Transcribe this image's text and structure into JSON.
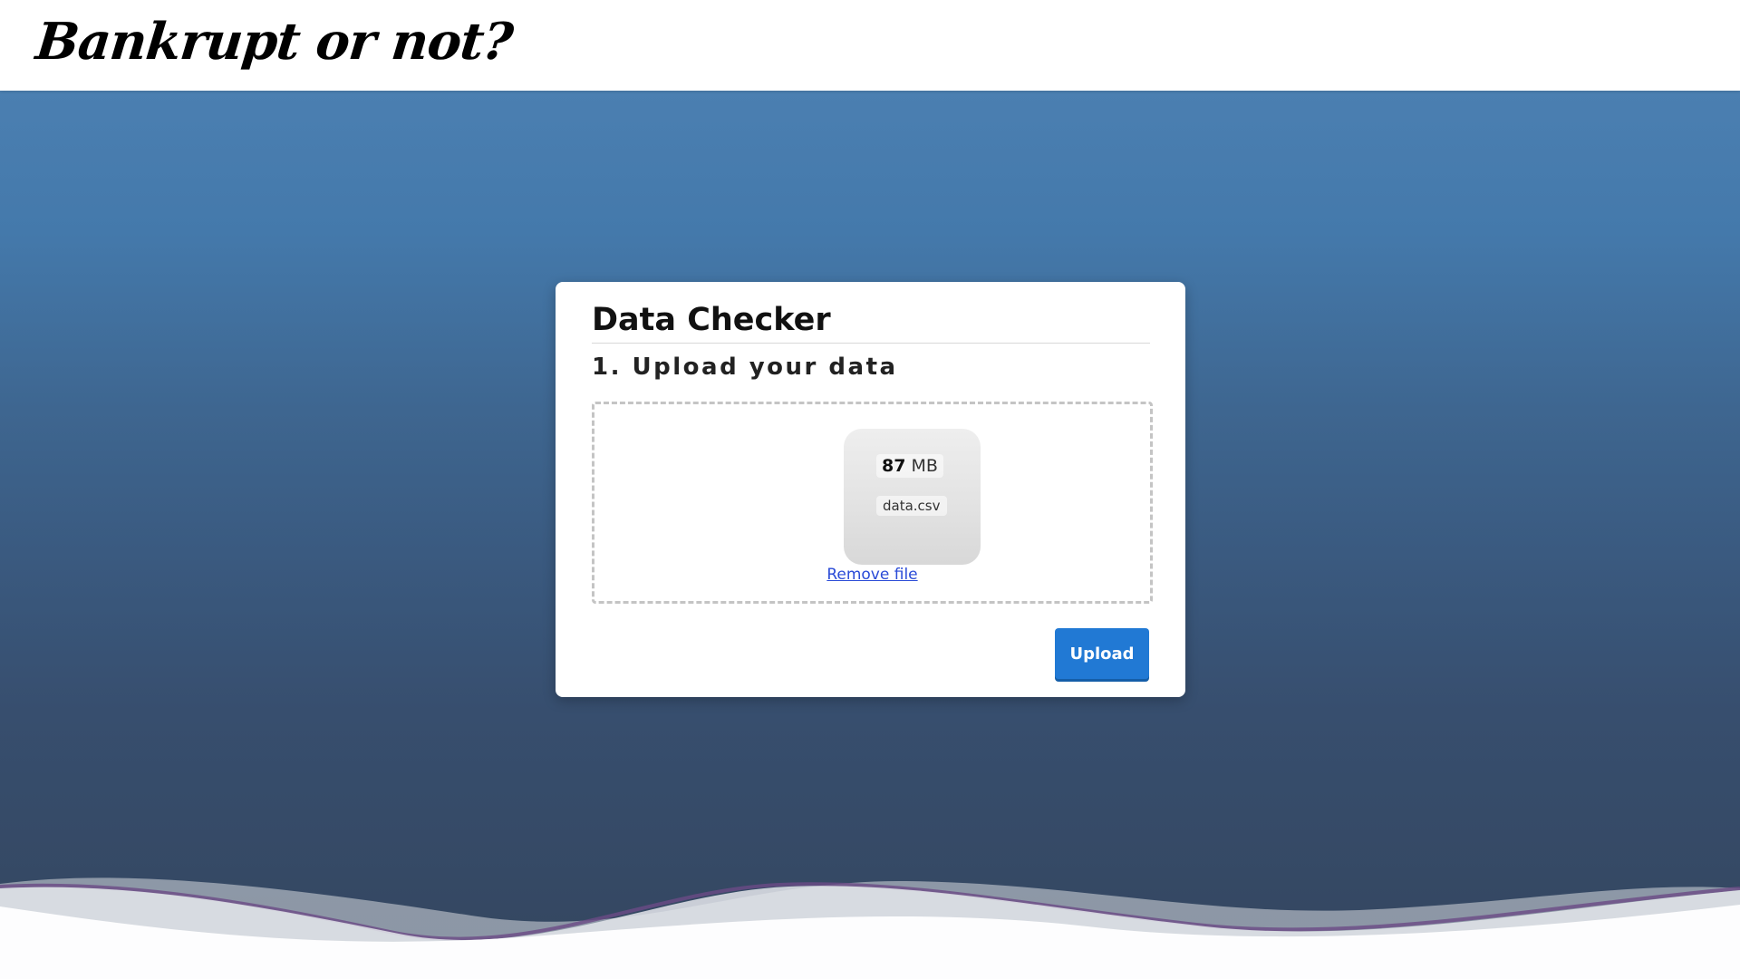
{
  "header": {
    "brand": "Bankrupt or not?"
  },
  "card": {
    "title": "Data Checker",
    "step_title": "1. Upload your data",
    "file": {
      "size_value": "87",
      "size_unit": "MB",
      "name": "data.csv",
      "remove_label": "Remove file"
    },
    "upload_label": "Upload"
  },
  "colors": {
    "gradient_top": "#4b7fb1",
    "gradient_bottom": "#34465f",
    "upload_button": "#2179d4",
    "link": "#2a4bd7"
  }
}
